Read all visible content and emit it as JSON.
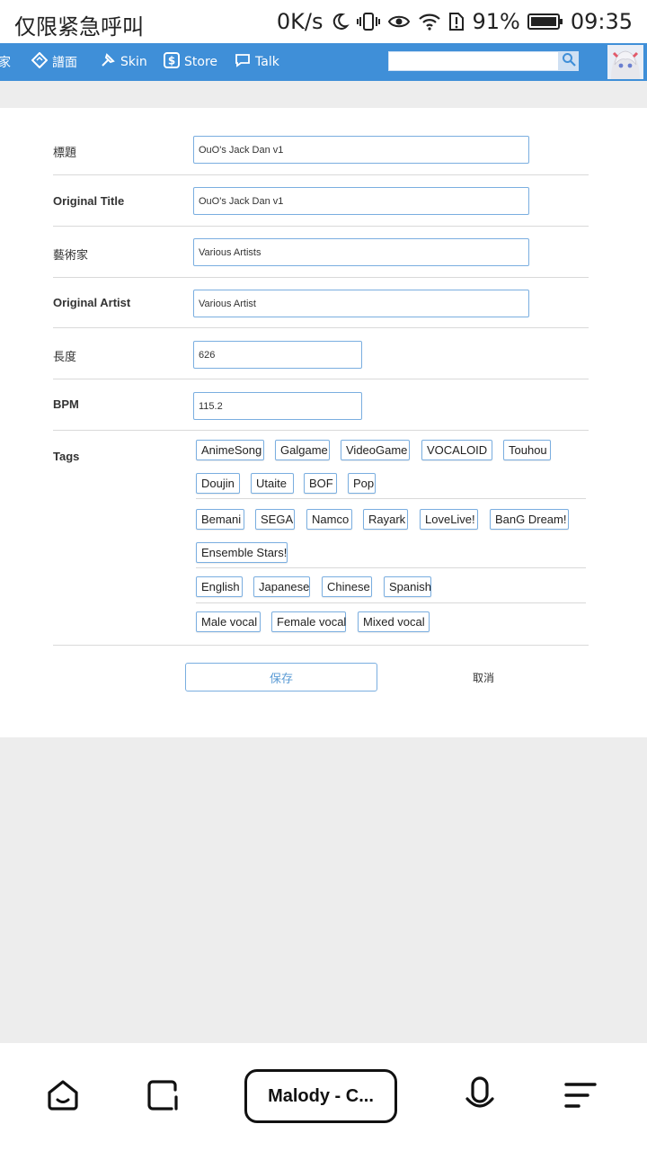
{
  "status_bar": {
    "carrier": "仅限紧急呼叫",
    "speed": "0K/s",
    "battery": "91%",
    "time": "09:35"
  },
  "nav": {
    "items": [
      {
        "label": "家",
        "icon": "house-icon"
      },
      {
        "label": "譜面",
        "icon": "chart-icon"
      },
      {
        "label": "Skin",
        "icon": "brush-icon"
      },
      {
        "label": "Store",
        "icon": "dollar-icon"
      },
      {
        "label": "Talk",
        "icon": "chat-icon"
      }
    ],
    "search_value": ""
  },
  "form": {
    "rows": [
      {
        "label": "標題",
        "value": "OuO's Jack Dan v1"
      },
      {
        "label": "Original Title",
        "value": "OuO's Jack Dan v1"
      },
      {
        "label": "藝術家",
        "value": "Various Artists"
      },
      {
        "label": "Original Artist",
        "value": "Various Artist"
      },
      {
        "label": "長度",
        "value": "626"
      },
      {
        "label": "BPM",
        "value": "115.2"
      }
    ],
    "tags_label": "Tags",
    "tag_groups": [
      [
        "AnimeSong",
        "Galgame",
        "VideoGame",
        "VOCALOID",
        "Touhou",
        "Doujin",
        "Utaite",
        "BOF",
        "Pop"
      ],
      [
        "Bemani",
        "SEGA",
        "Namco",
        "Rayark",
        "LoveLive!",
        "BanG Dream!",
        "Ensemble Stars!"
      ],
      [
        "English",
        "Japanese",
        "Chinese",
        "Spanish"
      ],
      [
        "Male vocal",
        "Female vocal",
        "Mixed vocal"
      ]
    ],
    "save_label": "保存",
    "cancel_label": "取消"
  },
  "bottom_bar": {
    "tab_title": "Malody - C..."
  },
  "colors": {
    "nav_bg": "#3f8fd8",
    "accent_border": "#7aaee0",
    "page_bg": "#ededed"
  }
}
